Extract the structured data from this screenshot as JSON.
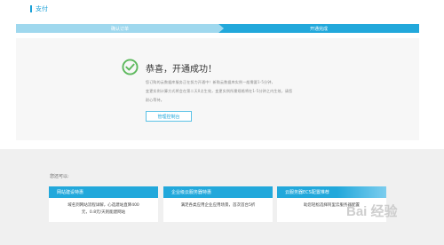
{
  "header": {
    "title": "支付"
  },
  "steps": [
    {
      "label": "确认订单"
    },
    {
      "label": "开通完成"
    }
  ],
  "result": {
    "title": "恭喜，开通成功！",
    "desc_line1": "您订购的云数据库服务正在努力开通中！新购云数据库实例一般需要1-5分钟，",
    "desc_line2": "变更实例计算方式将会在第二天0点生效，变更实例所需规格将在1-5分钟之内生效，请您",
    "desc_line3": "耐心等待。",
    "button_label": "管理控制台"
  },
  "recommend": {
    "heading": "您还可以:",
    "cards": [
      {
        "title": "网站建设特惠",
        "line1": "域名到网站流程详解，心选建站直降400",
        "line2": "元，0.8元/天则能建网站"
      },
      {
        "title": "企业级云服务器特惠",
        "line1": "满足各类应用企业应用场景，首次首台5折",
        "line2": ""
      },
      {
        "title": "云服务器ECS配置推荐",
        "line1": "助您轻松选择阿里云服务器配置",
        "line2": ""
      }
    ]
  },
  "watermark": {
    "text": "Bai 经验"
  },
  "colors": {
    "accent": "#22a8db",
    "success": "#5cb85c"
  },
  "icons": {
    "success": "check-circle-icon"
  }
}
